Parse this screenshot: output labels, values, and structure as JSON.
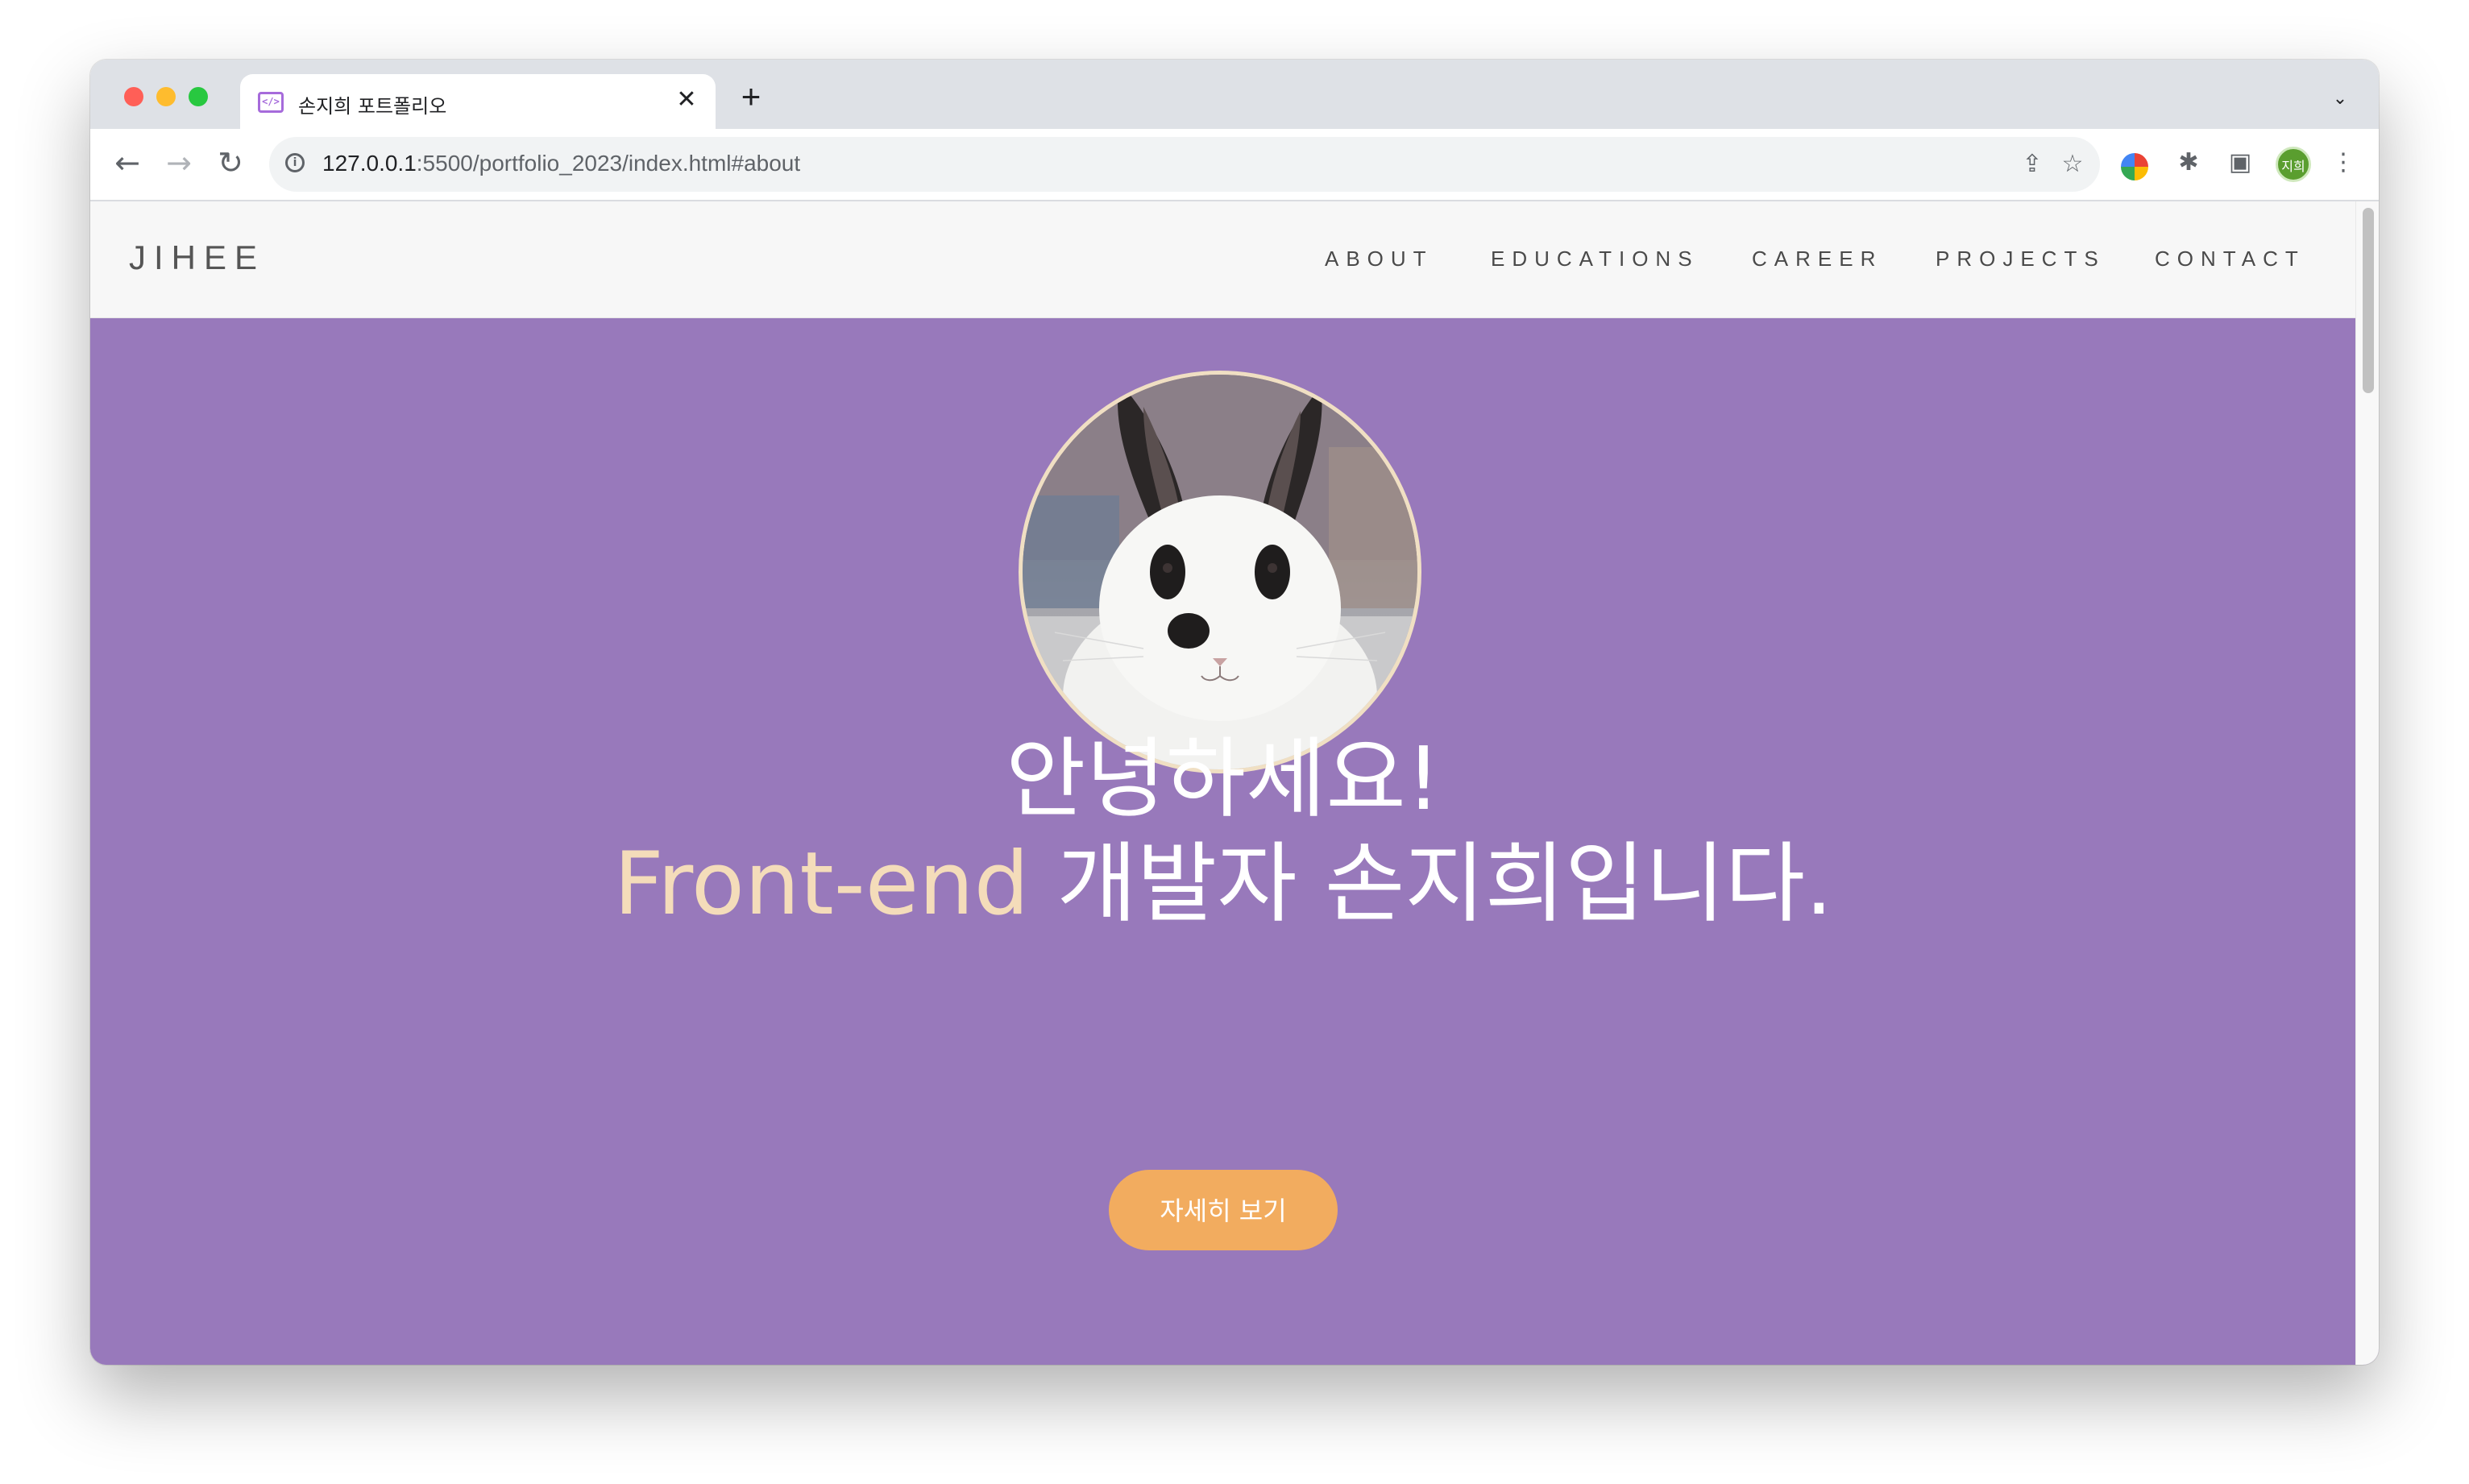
{
  "browser": {
    "tab": {
      "title": "손지희 포트폴리오",
      "favicon": "code-brackets-icon",
      "close_glyph": "✕"
    },
    "new_tab_glyph": "+",
    "tab_search_glyph": "⌄",
    "nav": {
      "back": "←",
      "forward": "→",
      "reload": "↻"
    },
    "address": {
      "host": "127.0.0.1",
      "path": ":5500/portfolio_2023/index.html#about",
      "info_glyph": "i"
    },
    "omnibox_icons": {
      "share": "⇪",
      "bookmark": "☆"
    },
    "toolbar_icons": {
      "extensions": "✱",
      "side_panel": "▣",
      "menu": "⋮"
    },
    "profile_label": "지희"
  },
  "site": {
    "logo": "JIHEE",
    "menu": [
      {
        "label": "ABOUT"
      },
      {
        "label": "EDUCATIONS"
      },
      {
        "label": "CAREER"
      },
      {
        "label": "PROJECTS"
      },
      {
        "label": "CONTACT"
      }
    ],
    "hero": {
      "greeting": "안녕하세요!",
      "tagline_accent": "Front-end",
      "tagline_rest": " 개발자 손지희입니다.",
      "button": "자세히 보기",
      "avatar_alt": "rabbit-photo"
    }
  },
  "colors": {
    "hero_bg": "#9879bb",
    "accent_text": "#f4dcba",
    "button_bg": "#f2ac5f",
    "nav_bg": "#f7f7f7"
  }
}
